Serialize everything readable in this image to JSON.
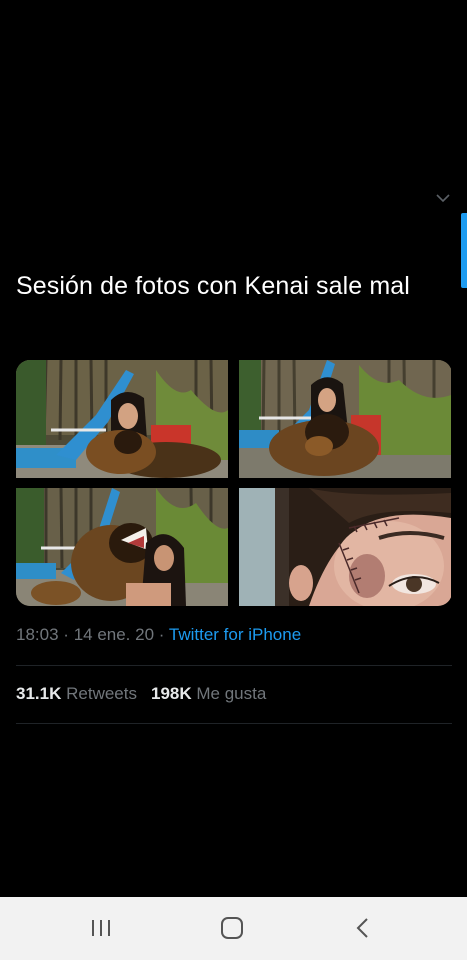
{
  "tweet": {
    "text": "Sesión de fotos con Kenai sale mal",
    "time": "18:03",
    "separator": "·",
    "date": "14 ene. 20",
    "source": "Twitter for iPhone"
  },
  "stats": {
    "retweets_count": "31.1K",
    "retweets_label": "Retweets",
    "likes_count": "198K",
    "likes_label": "Me gusta"
  },
  "media": {
    "photos": [
      {
        "name": "photo-girl-dog-pool-1"
      },
      {
        "name": "photo-girl-dog-pool-2"
      },
      {
        "name": "photo-dog-attacking-girl"
      },
      {
        "name": "photo-face-wound-closeup"
      }
    ]
  },
  "icons": {
    "more": "chevron-down-icon",
    "nav_recents": "recents-icon",
    "nav_home": "home-icon",
    "nav_back": "back-icon"
  },
  "colors": {
    "background": "#000000",
    "accent": "#1d9bf0",
    "muted_text": "#71767b",
    "navbar": "#f2f2f2"
  }
}
